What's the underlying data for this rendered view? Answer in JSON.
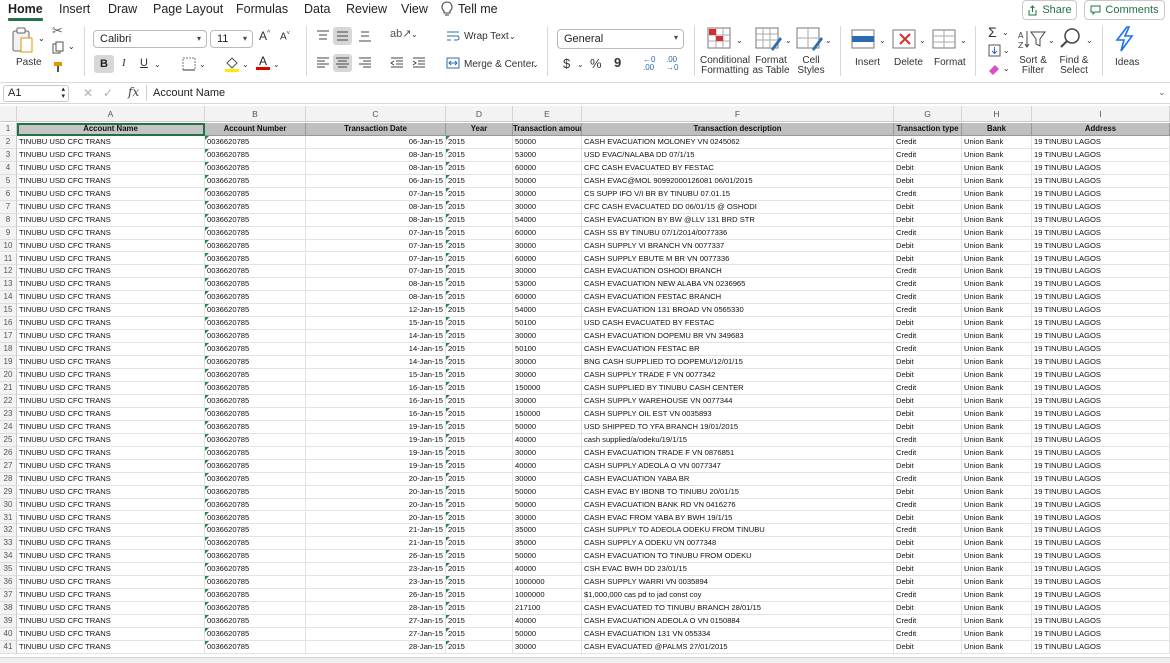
{
  "menu": {
    "tabs": [
      "Home",
      "Insert",
      "Draw",
      "Page Layout",
      "Formulas",
      "Data",
      "Review",
      "View"
    ],
    "tell_me": "Tell me",
    "share": "Share",
    "comments": "Comments"
  },
  "ribbon": {
    "paste": "Paste",
    "font_name": "Calibri",
    "font_size": "11",
    "wrap_text": "Wrap Text",
    "merge_center": "Merge & Center",
    "number_format": "General",
    "conditional_formatting": [
      "Conditional",
      "Formatting"
    ],
    "format_as_table": [
      "Format",
      "as Table"
    ],
    "cell_styles": [
      "Cell",
      "Styles"
    ],
    "insert": "Insert",
    "delete": "Delete",
    "format": "Format",
    "sort_filter": [
      "Sort &",
      "Filter"
    ],
    "find_select": [
      "Find &",
      "Select"
    ],
    "ideas": "Ideas",
    "bold": "B",
    "italic": "I",
    "underline": "U",
    "currency": "$",
    "percent": "%",
    "comma": "9"
  },
  "formula_bar": {
    "cell_ref": "A1",
    "fx": "fx",
    "content": "Account Name"
  },
  "columns": [
    "A",
    "B",
    "C",
    "D",
    "E",
    "F",
    "G",
    "H",
    "I"
  ],
  "headers": [
    "Account Name",
    "Account Number",
    "Transaction Date",
    "Year",
    "Transaction amount",
    "Transaction description",
    "Transaction type",
    "Bank",
    "Address"
  ],
  "rows": [
    [
      "TINUBU USD CFC TRANS",
      "0036620785",
      "06-Jan-15",
      "2015",
      "50000",
      "CASH EVACUATION MOLONEY VN 0245062",
      "Credit",
      "Union Bank",
      "19 TINUBU LAGOS"
    ],
    [
      "TINUBU USD CFC TRANS",
      "0036620785",
      "08-Jan-15",
      "2015",
      "53000",
      "USD EVAC/NALABA DD 07/1/15",
      "Credit",
      "Union Bank",
      "19 TINUBU LAGOS"
    ],
    [
      "TINUBU USD CFC TRANS",
      "0036620785",
      "08-Jan-15",
      "2015",
      "60000",
      "CFC CASH EVACUATED BY FESTAC",
      "Debit",
      "Union Bank",
      "19 TINUBU LAGOS"
    ],
    [
      "TINUBU USD CFC TRANS",
      "0036620785",
      "06-Jan-15",
      "2015",
      "50000",
      "CASH EVAC@MOL 90992000126081 06/01/2015",
      "Debit",
      "Union Bank",
      "19 TINUBU LAGOS"
    ],
    [
      "TINUBU USD CFC TRANS",
      "0036620785",
      "07-Jan-15",
      "2015",
      "30000",
      "CS SUPP IFO V/I BR BY TINUBU 07.01.15",
      "Credit",
      "Union Bank",
      "19 TINUBU LAGOS"
    ],
    [
      "TINUBU USD CFC TRANS",
      "0036620785",
      "08-Jan-15",
      "2015",
      "30000",
      "CFC CASH EVACUATED DD 06/01/15 @ OSHODI",
      "Debit",
      "Union Bank",
      "19 TINUBU LAGOS"
    ],
    [
      "TINUBU USD CFC TRANS",
      "0036620785",
      "08-Jan-15",
      "2015",
      "54000",
      "CASH EVACUATION BY BW @LLV 131 BRD STR",
      "Debit",
      "Union Bank",
      "19 TINUBU LAGOS"
    ],
    [
      "TINUBU USD CFC TRANS",
      "0036620785",
      "07-Jan-15",
      "2015",
      "60000",
      "CASH SS BY TINUBU 07/1/2014/0077336",
      "Credit",
      "Union Bank",
      "19 TINUBU LAGOS"
    ],
    [
      "TINUBU USD CFC TRANS",
      "0036620785",
      "07-Jan-15",
      "2015",
      "30000",
      "CASH SUPPLY VI BRANCH VN 0077337",
      "Debit",
      "Union Bank",
      "19 TINUBU LAGOS"
    ],
    [
      "TINUBU USD CFC TRANS",
      "0036620785",
      "07-Jan-15",
      "2015",
      "60000",
      "CASH SUPPLY EBUTE M BR VN 0077336",
      "Debit",
      "Union Bank",
      "19 TINUBU LAGOS"
    ],
    [
      "TINUBU USD CFC TRANS",
      "0036620785",
      "07-Jan-15",
      "2015",
      "30000",
      "CASH EVACUATION OSHODI BRANCH",
      "Credit",
      "Union Bank",
      "19 TINUBU LAGOS"
    ],
    [
      "TINUBU USD CFC TRANS",
      "0036620785",
      "08-Jan-15",
      "2015",
      "53000",
      "CASH EVACUATION NEW ALABA VN 0236965",
      "Credit",
      "Union Bank",
      "19 TINUBU LAGOS"
    ],
    [
      "TINUBU USD CFC TRANS",
      "0036620785",
      "08-Jan-15",
      "2015",
      "60000",
      "CASH EVACUATION FESTAC BRANCH",
      "Credit",
      "Union Bank",
      "19 TINUBU LAGOS"
    ],
    [
      "TINUBU USD CFC TRANS",
      "0036620785",
      "12-Jan-15",
      "2015",
      "54000",
      "CASH EVACUATION 131 BROAD VN 0565330",
      "Credit",
      "Union Bank",
      "19 TINUBU LAGOS"
    ],
    [
      "TINUBU USD CFC TRANS",
      "0036620785",
      "15-Jan-15",
      "2015",
      "50100",
      "USD CASH EVACUATED BY FESTAC",
      "Debit",
      "Union Bank",
      "19 TINUBU LAGOS"
    ],
    [
      "TINUBU USD CFC TRANS",
      "0036620785",
      "14-Jan-15",
      "2015",
      "30000",
      "CASH EVACUATION DOPEMU BR VN 349683",
      "Credit",
      "Union Bank",
      "19 TINUBU LAGOS"
    ],
    [
      "TINUBU USD CFC TRANS",
      "0036620785",
      "14-Jan-15",
      "2015",
      "50100",
      "CASH EVACUATION FESTAC BR",
      "Credit",
      "Union Bank",
      "19 TINUBU LAGOS"
    ],
    [
      "TINUBU USD CFC TRANS",
      "0036620785",
      "14-Jan-15",
      "2015",
      "30000",
      "BNG CASH SUPPLIED TO DOPEMU/12/01/15",
      "Debit",
      "Union Bank",
      "19 TINUBU LAGOS"
    ],
    [
      "TINUBU USD CFC TRANS",
      "0036620785",
      "15-Jan-15",
      "2015",
      "30000",
      "CASH SUPPLY TRADE F VN 0077342",
      "Debit",
      "Union Bank",
      "19 TINUBU LAGOS"
    ],
    [
      "TINUBU USD CFC TRANS",
      "0036620785",
      "16-Jan-15",
      "2015",
      "150000",
      "CASH SUPPLIED BY TINUBU CASH CENTER",
      "Credit",
      "Union Bank",
      "19 TINUBU LAGOS"
    ],
    [
      "TINUBU USD CFC TRANS",
      "0036620785",
      "16-Jan-15",
      "2015",
      "30000",
      "CASH SUPPLY WAREHOUSE VN 0077344",
      "Debit",
      "Union Bank",
      "19 TINUBU LAGOS"
    ],
    [
      "TINUBU USD CFC TRANS",
      "0036620785",
      "16-Jan-15",
      "2015",
      "150000",
      "CASH SUPPLY OIL EST VN 0035893",
      "Debit",
      "Union Bank",
      "19 TINUBU LAGOS"
    ],
    [
      "TINUBU USD CFC TRANS",
      "0036620785",
      "19-Jan-15",
      "2015",
      "50000",
      "USD SHIPPED TO YFA BRANCH 19/01/2015",
      "Debit",
      "Union Bank",
      "19 TINUBU LAGOS"
    ],
    [
      "TINUBU USD CFC TRANS",
      "0036620785",
      "19-Jan-15",
      "2015",
      "40000",
      "cash supplied/a/odeku/19/1/15",
      "Credit",
      "Union Bank",
      "19 TINUBU LAGOS"
    ],
    [
      "TINUBU USD CFC TRANS",
      "0036620785",
      "19-Jan-15",
      "2015",
      "30000",
      "CASH EVACUATION TRADE F VN 0876851",
      "Credit",
      "Union Bank",
      "19 TINUBU LAGOS"
    ],
    [
      "TINUBU USD CFC TRANS",
      "0036620785",
      "19-Jan-15",
      "2015",
      "40000",
      "CASH SUPPLY ADEOLA O VN 0077347",
      "Debit",
      "Union Bank",
      "19 TINUBU LAGOS"
    ],
    [
      "TINUBU USD CFC TRANS",
      "0036620785",
      "20-Jan-15",
      "2015",
      "30000",
      "CASH EVACUATION YABA BR",
      "Credit",
      "Union Bank",
      "19 TINUBU LAGOS"
    ],
    [
      "TINUBU USD CFC TRANS",
      "0036620785",
      "20-Jan-15",
      "2015",
      "50000",
      "CASH EVAC BY IBDNB TO TINUBU 20/01/15",
      "Debit",
      "Union Bank",
      "19 TINUBU LAGOS"
    ],
    [
      "TINUBU USD CFC TRANS",
      "0036620785",
      "20-Jan-15",
      "2015",
      "50000",
      "CASH EVACUATION BANK RD VN 0416276",
      "Credit",
      "Union Bank",
      "19 TINUBU LAGOS"
    ],
    [
      "TINUBU USD CFC TRANS",
      "0036620785",
      "20-Jan-15",
      "2015",
      "30000",
      "CASH EVAC FROM YABA BY BWH 19/1/15",
      "Debit",
      "Union Bank",
      "19 TINUBU LAGOS"
    ],
    [
      "TINUBU USD CFC TRANS",
      "0036620785",
      "21-Jan-15",
      "2015",
      "35000",
      "CASH SUPPLY TO ADEOLA ODEKU FROM TINUBU",
      "Credit",
      "Union Bank",
      "19 TINUBU LAGOS"
    ],
    [
      "TINUBU USD CFC TRANS",
      "0036620785",
      "21-Jan-15",
      "2015",
      "35000",
      "CASH SUPPLY A ODEKU  VN 0077348",
      "Debit",
      "Union Bank",
      "19 TINUBU LAGOS"
    ],
    [
      "TINUBU USD CFC TRANS",
      "0036620785",
      "26-Jan-15",
      "2015",
      "50000",
      "CASH EVACUATION TO TINUBU FROM ODEKU",
      "Debit",
      "Union Bank",
      "19 TINUBU LAGOS"
    ],
    [
      "TINUBU USD CFC TRANS",
      "0036620785",
      "23-Jan-15",
      "2015",
      "40000",
      "CSH EVAC BWH DD 23/01/15",
      "Debit",
      "Union Bank",
      "19 TINUBU LAGOS"
    ],
    [
      "TINUBU USD CFC TRANS",
      "0036620785",
      "23-Jan-15",
      "2015",
      "1000000",
      "CASH SUPPLY WARRI VN 0035894",
      "Debit",
      "Union Bank",
      "19 TINUBU LAGOS"
    ],
    [
      "TINUBU USD CFC TRANS",
      "0036620785",
      "26-Jan-15",
      "2015",
      "1000000",
      "$1,000,000 cas pd to jad const coy",
      "Credit",
      "Union Bank",
      "19 TINUBU LAGOS"
    ],
    [
      "TINUBU USD CFC TRANS",
      "0036620785",
      "28-Jan-15",
      "2015",
      "217100",
      "CASH EVACUATED TO TINUBU BRANCH 28/01/15",
      "Debit",
      "Union Bank",
      "19 TINUBU LAGOS"
    ],
    [
      "TINUBU USD CFC TRANS",
      "0036620785",
      "27-Jan-15",
      "2015",
      "40000",
      "CASH EVACUATION ADEOLA O VN 0150884",
      "Credit",
      "Union Bank",
      "19 TINUBU LAGOS"
    ],
    [
      "TINUBU USD CFC TRANS",
      "0036620785",
      "27-Jan-15",
      "2015",
      "50000",
      "CASH EVACUATION 131 VN 055334",
      "Credit",
      "Union Bank",
      "19 TINUBU LAGOS"
    ],
    [
      "TINUBU USD CFC TRANS",
      "0036620785",
      "28-Jan-15",
      "2015",
      "30000",
      "CASH EVACUATED @PALMS 27/01/2015",
      "Debit",
      "Union Bank",
      "19 TINUBU LAGOS"
    ]
  ],
  "colors": {
    "accent": "#217346",
    "header_fill": "#bfbfbf",
    "ideas_icon": "#1a73e8",
    "font_color_bar": "#e00000",
    "highlight_bar": "#ffeb00"
  }
}
